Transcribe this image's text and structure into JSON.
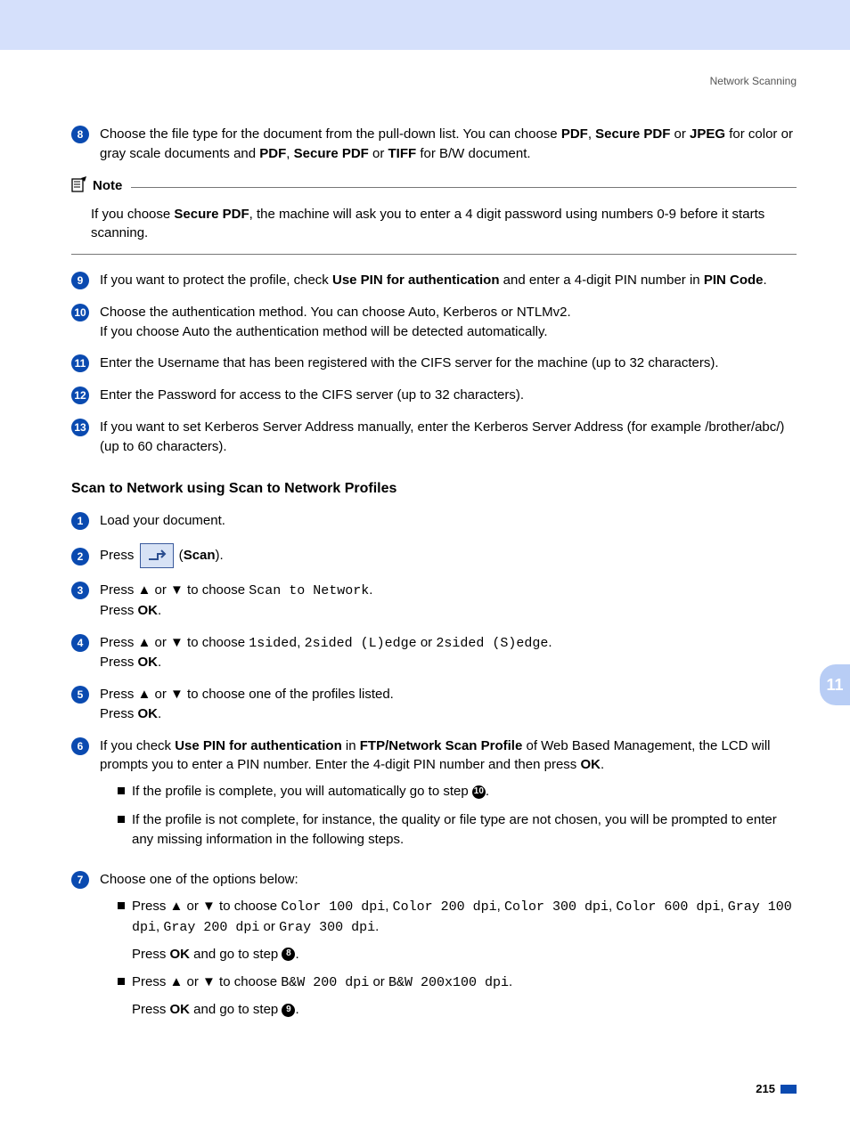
{
  "header": {
    "section": "Network Scanning"
  },
  "chapter": "11",
  "page_number": "215",
  "steps_a": {
    "s8": {
      "num": "8",
      "text_pre": "Choose the file type for the document from the pull-down list. You can choose ",
      "b1": "PDF",
      "sep1": ", ",
      "b2": "Secure PDF",
      "sep2": " or ",
      "b3": "JPEG",
      "text_mid": " for color or gray scale documents and ",
      "b4": "PDF",
      "sep3": ", ",
      "b5": "Secure PDF",
      "sep4": " or ",
      "b6": "TIFF",
      "text_post": " for B/W document."
    },
    "note": {
      "label": "Note",
      "text_pre": "If you choose ",
      "b1": "Secure PDF",
      "text_post": ", the machine will ask you to enter a 4 digit password using numbers 0-9 before it starts scanning."
    },
    "s9": {
      "num": "9",
      "text_pre": "If you want to protect the profile, check ",
      "b1": "Use PIN for authentication",
      "text_mid": " and enter a 4-digit PIN number in ",
      "b2": "PIN Code",
      "text_post": "."
    },
    "s10": {
      "num": "10",
      "line1": "Choose the authentication method. You can choose Auto, Kerberos or NTLMv2.",
      "line2": "If you choose Auto the authentication method will be detected automatically."
    },
    "s11": {
      "num": "11",
      "text": "Enter the Username that has been registered with the CIFS server for the machine (up to 32 characters)."
    },
    "s12": {
      "num": "12",
      "text": "Enter the Password for access to the CIFS server (up to 32 characters)."
    },
    "s13": {
      "num": "13",
      "text": "If you want to set Kerberos Server Address manually, enter the Kerberos Server Address (for example /brother/abc/) (up to 60 characters)."
    }
  },
  "subhead": "Scan to Network using Scan to Network Profiles",
  "steps_b": {
    "s1": {
      "num": "1",
      "text": "Load your document."
    },
    "s2": {
      "num": "2",
      "pre": "Press ",
      "post": " (",
      "b": "Scan",
      "end": ")."
    },
    "s3": {
      "num": "3",
      "pre": "Press ▲ or ▼ to choose ",
      "mono": "Scan to Network",
      "post": ".",
      "ok_pre": "Press ",
      "ok": "OK",
      "ok_post": "."
    },
    "s4": {
      "num": "4",
      "pre": "Press ▲ or ▼ to choose ",
      "m1": "1sided",
      "c1": ", ",
      "m2": "2sided (L)edge",
      "or": " or ",
      "m3": "2sided (S)edge",
      "post": ".",
      "ok_pre": "Press ",
      "ok": "OK",
      "ok_post": "."
    },
    "s5": {
      "num": "5",
      "pre": "Press ▲ or ▼ to choose one of the profiles listed.",
      "ok_pre": "Press ",
      "ok": "OK",
      "ok_post": "."
    },
    "s6": {
      "num": "6",
      "pre": "If you check ",
      "b1": "Use PIN for authentication",
      "mid1": " in ",
      "b2": "FTP/Network Scan Profile",
      "mid2": " of Web Based Management, the LCD will prompts you to enter a PIN number. Enter the 4-digit PIN number and then press ",
      "b3": "OK",
      "post": ".",
      "sub1_pre": "If the profile is complete, you will automatically go to step ",
      "sub1_ref": "10",
      "sub1_post": ".",
      "sub2": "If the profile is not complete, for instance, the quality or file type are not chosen, you will be prompted to enter any missing information in the following steps."
    },
    "s7": {
      "num": "7",
      "lead": "Choose one of the options below:",
      "a_pre": "Press ▲ or ▼ to choose ",
      "a_m1": "Color 100 dpi",
      "a_c": ", ",
      "a_m2": "Color 200 dpi",
      "a_m3": "Color 300 dpi",
      "a_m4": "Color 600 dpi",
      "a_m5": "Gray 100 dpi",
      "a_m6": "Gray 200 dpi",
      "a_or": " or ",
      "a_m7": "Gray 300 dpi",
      "a_post": ".",
      "a_ok_pre": "Press ",
      "a_ok": "OK",
      "a_ok_mid": " and go to step ",
      "a_ref": "8",
      "a_ok_post": ".",
      "b_pre": "Press ▲ or ▼ to choose ",
      "b_m1": "B&W 200 dpi",
      "b_or": " or ",
      "b_m2": "B&W 200x100 dpi",
      "b_post": ".",
      "b_ok_pre": "Press ",
      "b_ok": "OK",
      "b_ok_mid": " and go to step ",
      "b_ref": "9",
      "b_ok_post": "."
    }
  }
}
